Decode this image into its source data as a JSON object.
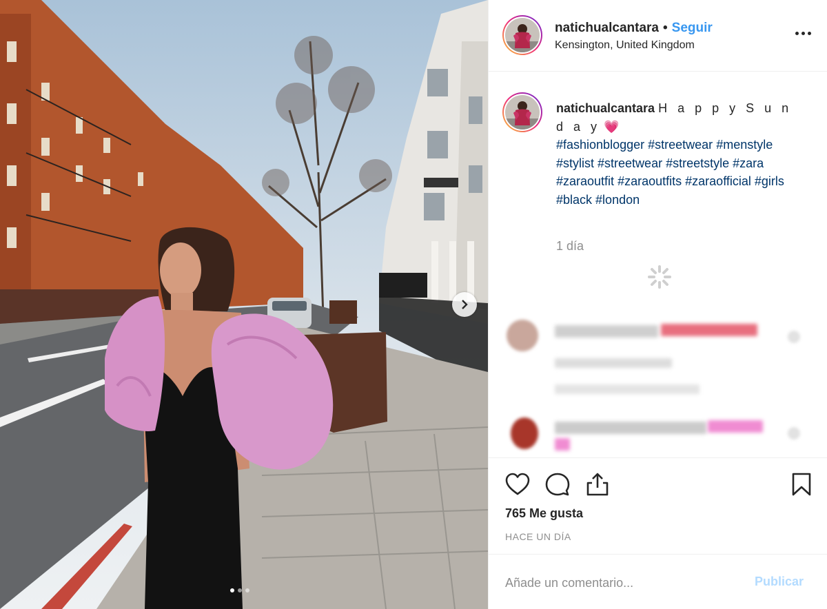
{
  "post": {
    "username": "natichualcantara",
    "follow_label": "Seguir",
    "header_dot": "•",
    "location": "Kensington, United Kingdom"
  },
  "caption": {
    "username": "natichualcantara",
    "text": "H a p p y S u n d a y",
    "emoji": "💗",
    "hashtags": [
      "#fashionblogger",
      "#streetwear",
      "#menstyle",
      "#stylist",
      "#streetwear",
      "#streetstyle",
      "#zara",
      "#zaraoutfit",
      "#zaraoutfits",
      "#zaraofficial",
      "#girls",
      "#black",
      "#london"
    ],
    "age": "1 día"
  },
  "engagement": {
    "likes": "765 Me gusta",
    "timestamp": "HACE UN DÍA"
  },
  "comment_form": {
    "placeholder": "Añade un comentario...",
    "publish_label": "Publicar"
  },
  "carousel": {
    "count": 3,
    "active_index": 0
  },
  "icons": {
    "like": "heart-icon",
    "comment": "comment-bubble-icon",
    "share": "share-icon",
    "save": "bookmark-icon",
    "more": "more-options-icon",
    "next": "chevron-right-icon",
    "loading": "loading-spinner-icon"
  },
  "colors": {
    "follow": "#3897f0",
    "hashtag": "#003569",
    "muted": "#8e8e8e",
    "publish_disabled": "#b3dbff",
    "text": "#262626"
  }
}
